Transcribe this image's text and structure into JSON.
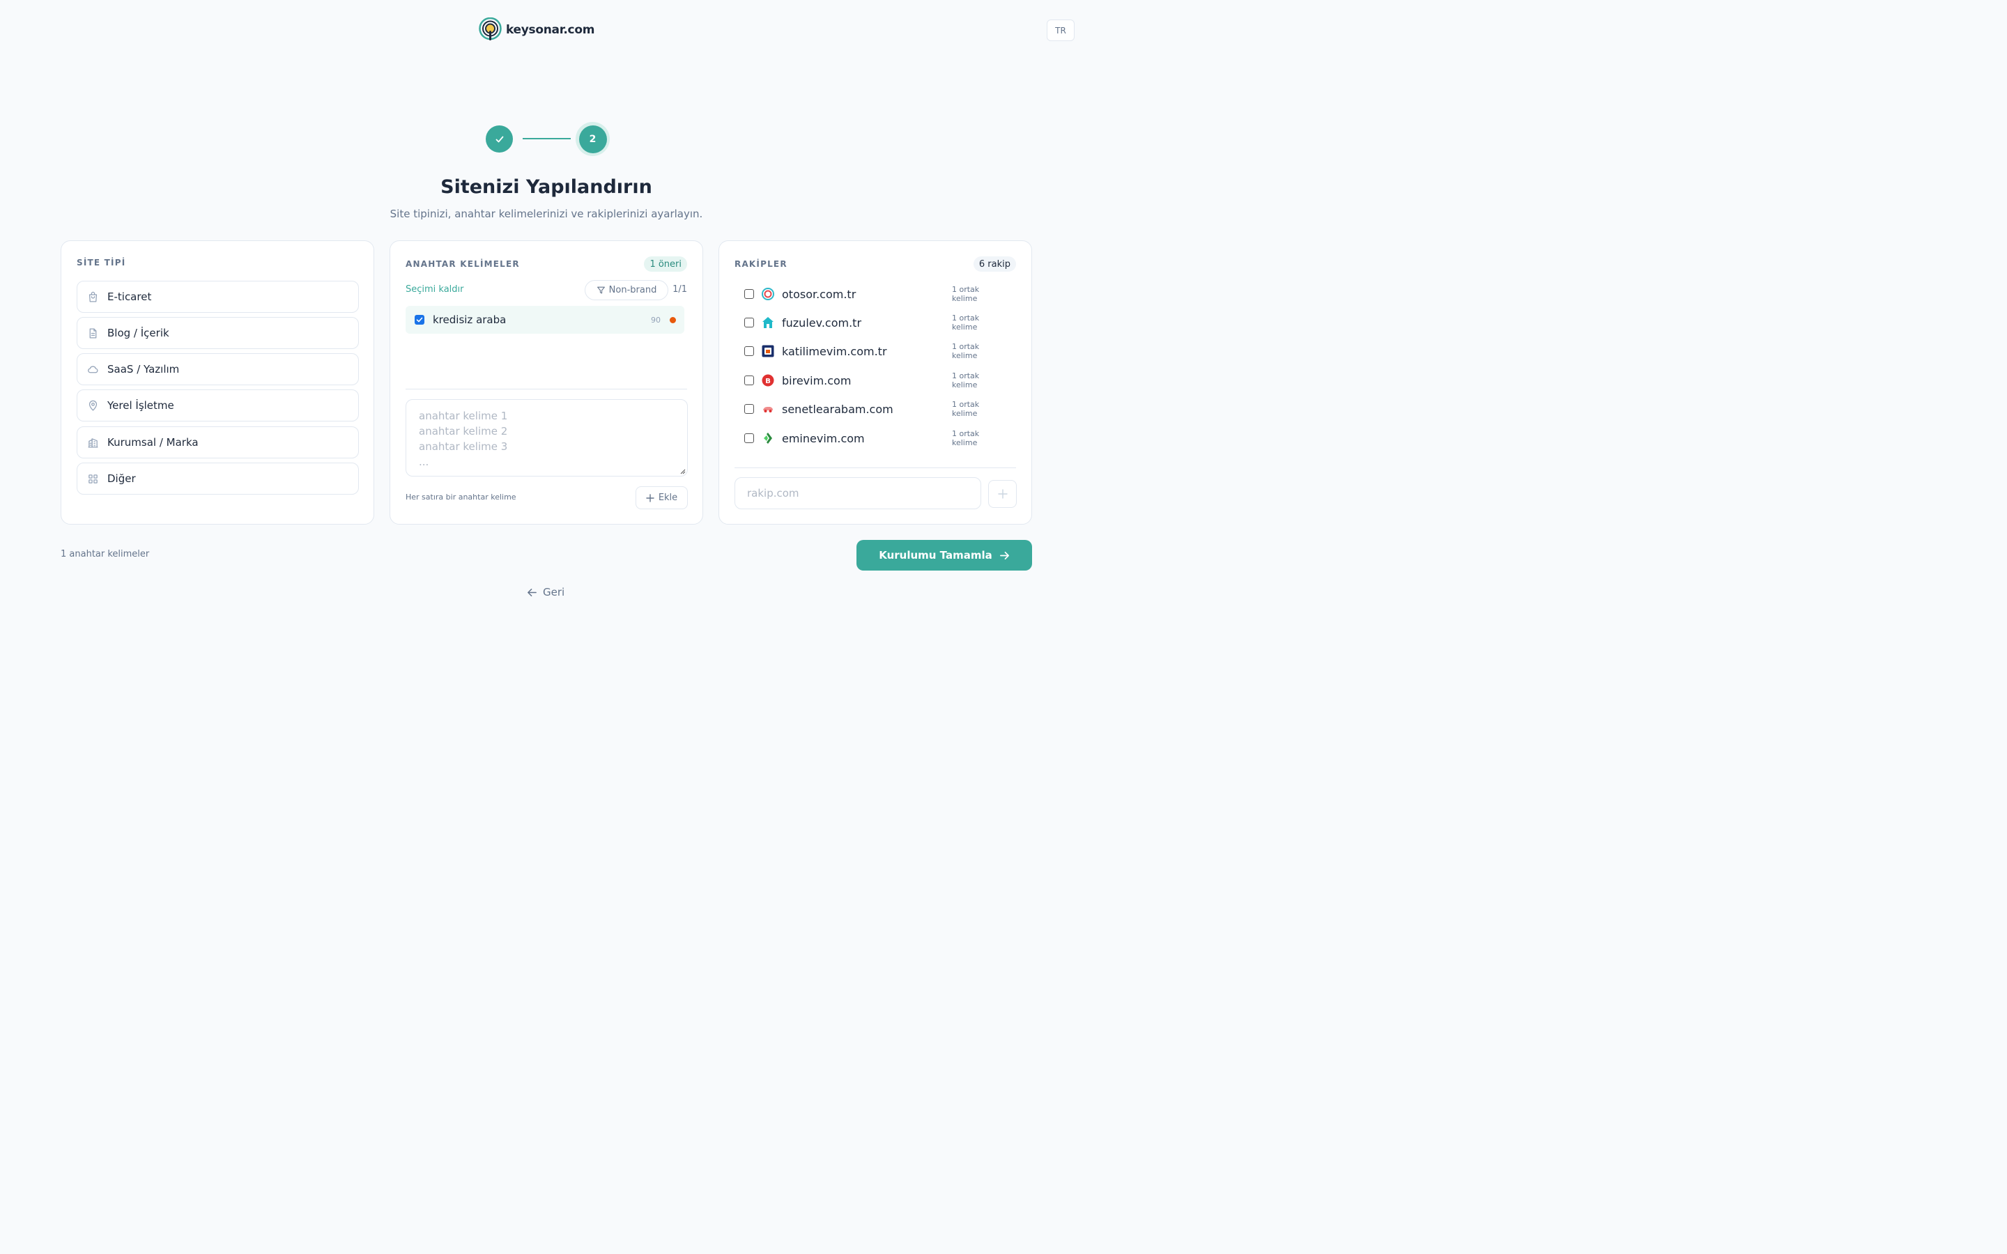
{
  "header": {
    "logo_text": "keysonar.com",
    "language": "TR"
  },
  "stepper": {
    "current_step": "2",
    "completed_icon": "check-icon"
  },
  "page": {
    "title": "Sitenizi Yapılandırın",
    "subtitle": "Site tipinizi, anahtar kelimelerinizi ve rakiplerinizi ayarlayın."
  },
  "site_type": {
    "label": "SİTE TİPİ",
    "options": [
      {
        "label": "E-ticaret",
        "icon": "shopping-bag-icon"
      },
      {
        "label": "Blog / İçerik",
        "icon": "document-icon"
      },
      {
        "label": "SaaS / Yazılım",
        "icon": "cloud-icon"
      },
      {
        "label": "Yerel İşletme",
        "icon": "map-pin-icon"
      },
      {
        "label": "Kurumsal / Marka",
        "icon": "building-icon"
      },
      {
        "label": "Diğer",
        "icon": "grid-icon"
      }
    ]
  },
  "keywords": {
    "label": "ANAHTAR KELİMELER",
    "suggestion_badge": "1 öneri",
    "deselect_label": "Seçimi kaldır",
    "filter_label": "Non-brand",
    "count": "1/1",
    "items": [
      {
        "text": "kredisiz araba",
        "volume": "90",
        "checked": true,
        "dot_color": "#e8590c"
      }
    ],
    "textarea_placeholder": "anahtar kelime 1\nanahtar kelime 2\nanahtar kelime 3\n...",
    "hint": "Her satıra bir anahtar kelime",
    "add_label": "Ekle"
  },
  "competitors": {
    "label": "RAKİPLER",
    "count_badge": "6 rakip",
    "items": [
      {
        "domain": "otosor.com.tr",
        "common": "1 ortak kelime",
        "checked": false
      },
      {
        "domain": "fuzulev.com.tr",
        "common": "1 ortak kelime",
        "checked": false
      },
      {
        "domain": "katilimevim.com.tr",
        "common": "1 ortak kelime",
        "checked": false
      },
      {
        "domain": "birevim.com",
        "common": "1 ortak kelime",
        "checked": false
      },
      {
        "domain": "senetlearabam.com",
        "common": "1 ortak kelime",
        "checked": false
      },
      {
        "domain": "eminevim.com",
        "common": "1 ortak kelime",
        "checked": false
      }
    ],
    "input_placeholder": "rakip.com"
  },
  "footer": {
    "keyword_count": "1 anahtar kelimeler",
    "finish_label": "Kurulumu Tamamla",
    "back_label": "Geri"
  },
  "colors": {
    "accent": "#3aa99b",
    "background": "#f8fafc",
    "text": "#1e293b",
    "muted": "#64748b",
    "border": "#e2e8f0"
  }
}
